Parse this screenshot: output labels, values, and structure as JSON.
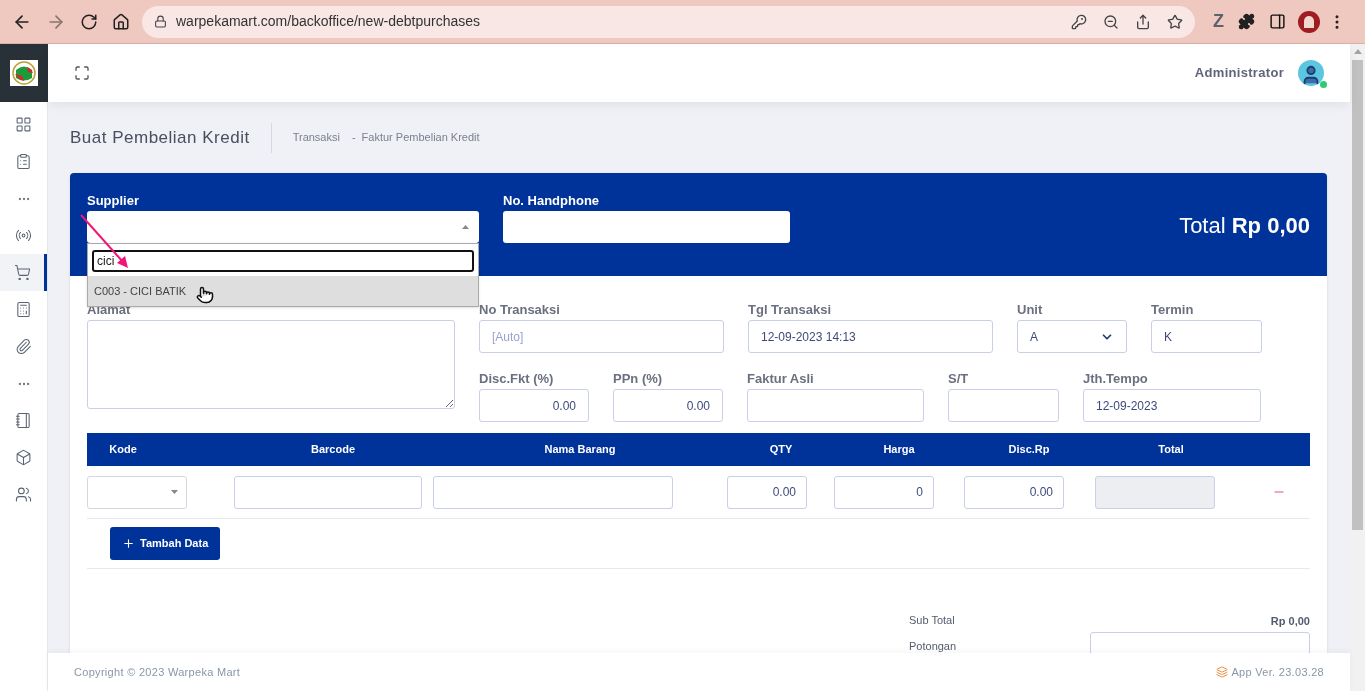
{
  "browser": {
    "url": "warpekamart.com/backoffice/new-debtpurchases",
    "extension_label": "Z"
  },
  "header": {
    "user": "Administrator",
    "online": true
  },
  "sidebar": {
    "items": [
      {
        "kind": "link",
        "selected": false
      },
      {
        "kind": "link",
        "selected": false
      },
      {
        "kind": "more",
        "selected": false
      },
      {
        "kind": "link",
        "selected": false
      },
      {
        "kind": "link",
        "selected": true
      },
      {
        "kind": "link",
        "selected": false
      },
      {
        "kind": "link",
        "selected": false
      },
      {
        "kind": "more",
        "selected": false
      },
      {
        "kind": "link",
        "selected": false
      },
      {
        "kind": "link",
        "selected": false
      },
      {
        "kind": "link",
        "selected": false
      }
    ]
  },
  "page": {
    "title": "Buat Pembelian Kredit",
    "breadcrumb": [
      "Transaksi",
      "Faktur Pembelian Kredit"
    ],
    "breadcrumb_separator": "-"
  },
  "form": {
    "supplier": {
      "label": "Supplier",
      "dropdown": {
        "search": "cici",
        "options": [
          {
            "label": "C003 - CICI BATIK",
            "selected": true
          }
        ]
      }
    },
    "phone": {
      "label": "No. Handphone"
    },
    "total": {
      "label": "Total",
      "amount": "Rp 0,00"
    },
    "address": {
      "label": "Alamat"
    },
    "fields": [
      {
        "label": "No Transaksi",
        "kind": "text",
        "placeholder": "[Auto]"
      },
      {
        "label": "Tgl Transaksi",
        "kind": "text",
        "value": "12-09-2023 14:13"
      },
      {
        "label": "Unit",
        "kind": "select",
        "value": "A"
      },
      {
        "label": "Termin",
        "kind": "text",
        "value": "K"
      },
      {
        "label": "Disc.Fkt (%)",
        "kind": "number",
        "value": "0.00"
      },
      {
        "label": "PPn (%)",
        "kind": "number",
        "value": "0.00"
      },
      {
        "label": "Faktur Asli",
        "kind": "text"
      },
      {
        "label": "S/T",
        "kind": "text"
      },
      {
        "label": "Jth.Tempo",
        "kind": "text",
        "value": "12-09-2023"
      }
    ]
  },
  "table": {
    "columns": [
      "Kode",
      "Barcode",
      "Nama Barang",
      "QTY",
      "Harga",
      "Disc.Rp",
      "Total"
    ],
    "row": [
      {
        "kind": "select"
      },
      {
        "kind": "text"
      },
      {
        "kind": "text"
      },
      {
        "kind": "number",
        "value": "0.00"
      },
      {
        "kind": "number",
        "value": "0"
      },
      {
        "kind": "number",
        "value": "0.00"
      },
      {
        "kind": "readonly"
      }
    ],
    "add_button": "Tambah Data"
  },
  "summary": [
    {
      "label": "Sub Total",
      "kind": "value",
      "value": "Rp 0,00"
    },
    {
      "label": "Potongan",
      "kind": "input"
    }
  ],
  "footer": {
    "copyright": "Copyright © 2023 Warpeka Mart",
    "version": "App Ver. 23.03.28"
  }
}
